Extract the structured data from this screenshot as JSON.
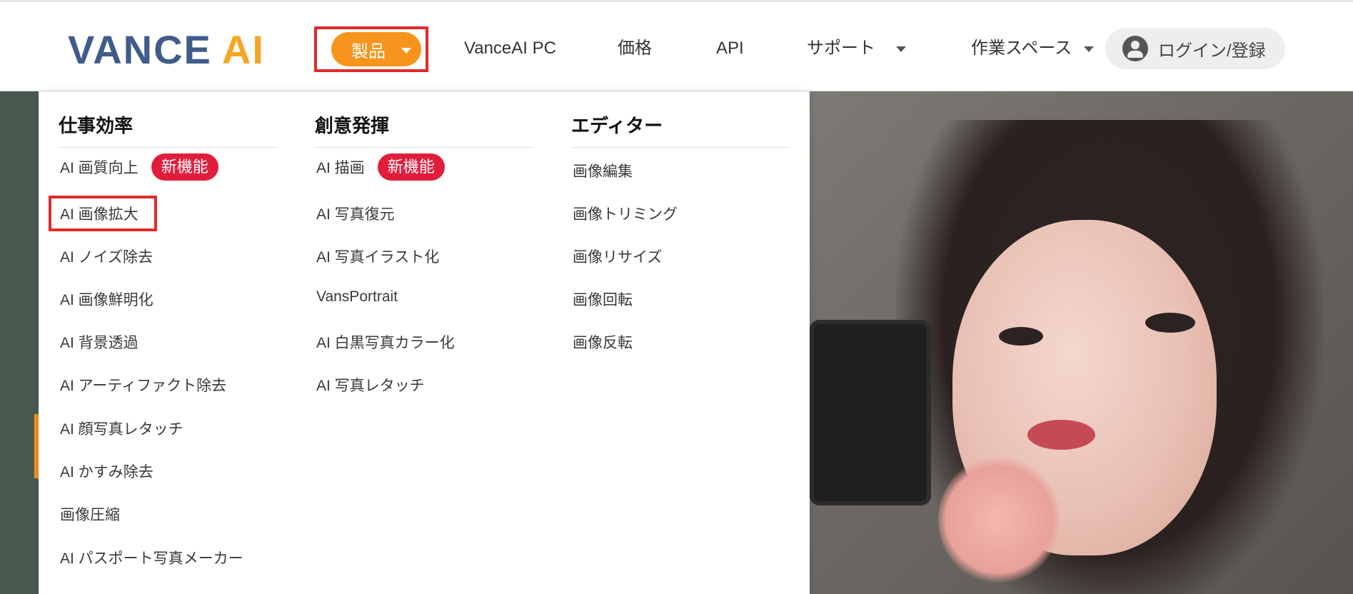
{
  "header": {
    "logo": {
      "part1": "VANCE",
      "part2": "AI"
    },
    "nav": {
      "products_label": "製品",
      "vanceai_pc_label": "VanceAI PC",
      "pricing_label": "価格",
      "api_label": "API",
      "support_label": "サポート",
      "workspace_label": "作業スペース",
      "login_label": "ログイン/登録"
    }
  },
  "dropdown": {
    "columns": [
      {
        "heading": "仕事効率",
        "items": [
          {
            "label": "AI 画質向上",
            "badge": "新機能"
          },
          {
            "label": "AI 画像拡大"
          },
          {
            "label": "AI ノイズ除去"
          },
          {
            "label": "AI 画像鮮明化"
          },
          {
            "label": "AI 背景透過"
          },
          {
            "label": "AI アーティファクト除去"
          },
          {
            "label": "AI 顔写真レタッチ"
          },
          {
            "label": "AI かすみ除去"
          },
          {
            "label": "画像圧縮"
          },
          {
            "label": "AI パスポート写真メーカー"
          }
        ]
      },
      {
        "heading": "創意発揮",
        "items": [
          {
            "label": "AI 描画",
            "badge": "新機能"
          },
          {
            "label": "AI 写真復元"
          },
          {
            "label": "AI 写真イラスト化"
          },
          {
            "label": "VansPortrait"
          },
          {
            "label": "AI 白黒写真カラー化"
          },
          {
            "label": "AI 写真レタッチ"
          }
        ]
      },
      {
        "heading": "エディター",
        "items": [
          {
            "label": "画像編集"
          },
          {
            "label": "画像トリミング"
          },
          {
            "label": "画像リサイズ"
          },
          {
            "label": "画像回転"
          },
          {
            "label": "画像反転"
          }
        ]
      }
    ]
  },
  "colors": {
    "brand_blue": "#3f5c8a",
    "brand_orange": "#f7941d",
    "badge_red": "#e01e3c",
    "highlight_red": "#e02a2a"
  }
}
